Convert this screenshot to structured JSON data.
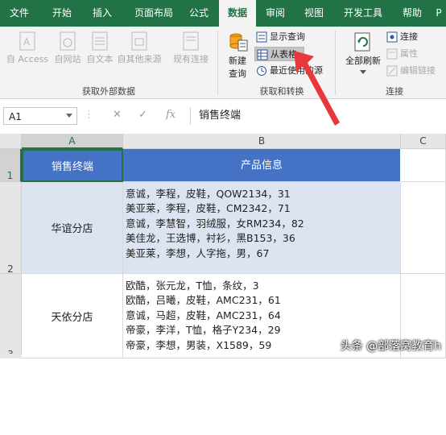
{
  "ribbon_tabs": [
    "文件",
    "开始",
    "插入",
    "页面布局",
    "公式",
    "数据",
    "审阅",
    "视图",
    "开发工具",
    "帮助",
    "P"
  ],
  "active_tab": "数据",
  "groups": {
    "external": {
      "label": "获取外部数据",
      "buttons": [
        "自 Access",
        "自网站",
        "自文本",
        "自其他来源",
        "现有连接"
      ]
    },
    "transform": {
      "label": "获取和转换",
      "new_query": [
        "新建",
        "查询"
      ],
      "show_queries": "显示查询",
      "from_table": "从表格",
      "recent_sources": "最近使用的源"
    },
    "connections": {
      "label": "连接",
      "refresh_all": "全部刷新",
      "connections": "连接",
      "properties": "属性",
      "edit_links": "编辑链接"
    }
  },
  "formula_bar": {
    "name_box": "A1",
    "fx": "fx",
    "content": "销售终端"
  },
  "columns": [
    "A",
    "B",
    "C"
  ],
  "rows": [
    "1",
    "2",
    "3"
  ],
  "table": {
    "headers": [
      "销售终端",
      "产品信息"
    ],
    "rows": [
      {
        "store": "华谊分店",
        "info": [
          "意诚，李程，皮鞋，QOW2134，31",
          "美亚莱，李程，皮鞋，CM2342，71",
          "意诚，李慧智，羽绒服，女RM234，82",
          "美佳龙，王选博，衬衫，黑B153，36",
          "美亚莱，李想，人字拖，男，67"
        ]
      },
      {
        "store": "天依分店",
        "info": [
          "欧酷，张元龙，T恤，条纹，3",
          "欧酷，吕曦，皮鞋，AMC231，61",
          "意诚，马超，皮鞋，AMC231，64",
          "帝豪，李洋，T恤，格子Y234，29",
          "帝豪，李想，男装，X1589，59"
        ]
      }
    ]
  },
  "watermark": "头条 @部落窝教育h",
  "colors": {
    "excel_green": "#217346",
    "header_blue": "#4472c4",
    "band_blue": "#dce4f2",
    "arrow_red": "#e8383d"
  }
}
